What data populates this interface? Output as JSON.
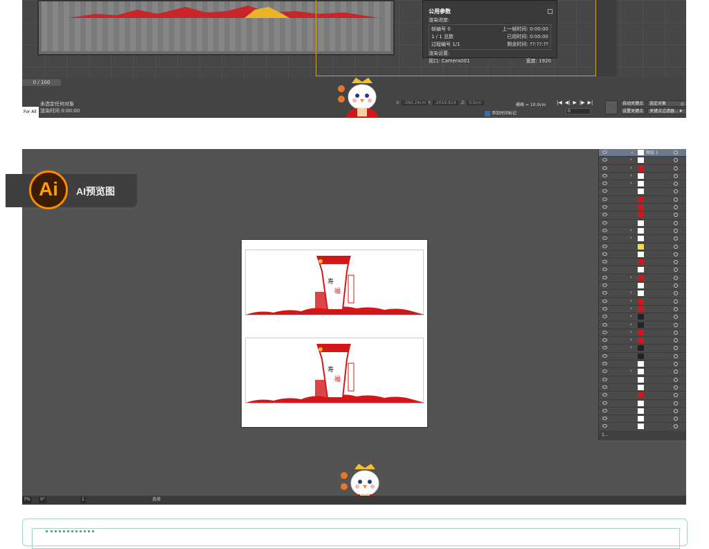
{
  "max_window": {
    "time_slider": "0 / 100",
    "listener_label": "For All",
    "status_line1": "未选定任何对象",
    "status_line2": "渲染时间  0:00:00",
    "coords": {
      "x_label": "X:",
      "x_value": "-560.24cm",
      "y_label": "Y:",
      "y_value": "-2019.914",
      "z_label": "Z:",
      "z_value": "0.0cm"
    },
    "grid": "栅格 = 10.0cm",
    "add_time_tag": "添加时间标记",
    "frame_value": "0",
    "auto_key": "自动关键点",
    "set_key": "设置关键点",
    "selected_object": "选定对象",
    "key_filter": "关键点过滤器...",
    "render_status": {
      "title": "公用参数",
      "progress_label": "渲染进度:",
      "frame_no_label": "帧编号",
      "frame_no_value": "0",
      "prev_frame_label": "上一帧时间:",
      "prev_frame_value": "0:00:00",
      "count_value": "1 / 1",
      "total_label": "总数",
      "elapsed_label": "已用时间:",
      "elapsed_value": "0:00:00",
      "process_label": "过程编号 1/1",
      "remaining_label": "剩余时间:",
      "remaining_value": "??:??:??",
      "settings_label": "渲染设置:",
      "viewport_label": "视口:",
      "viewport_value": "Camera001",
      "width_label": "宽度:",
      "width_value": "1920"
    }
  },
  "ai_window": {
    "badge_logo": "Ai",
    "badge_label": "AI预览图",
    "zoom": "7%",
    "rotation": "0°",
    "page": "1",
    "tool": "选择",
    "layer_top_name": "图层 1",
    "layers_footer": "1..."
  },
  "colors": {
    "accent_red": "#d4161a",
    "ai_orange": "#ff8a00",
    "teal_border": "#9fd3c9"
  }
}
